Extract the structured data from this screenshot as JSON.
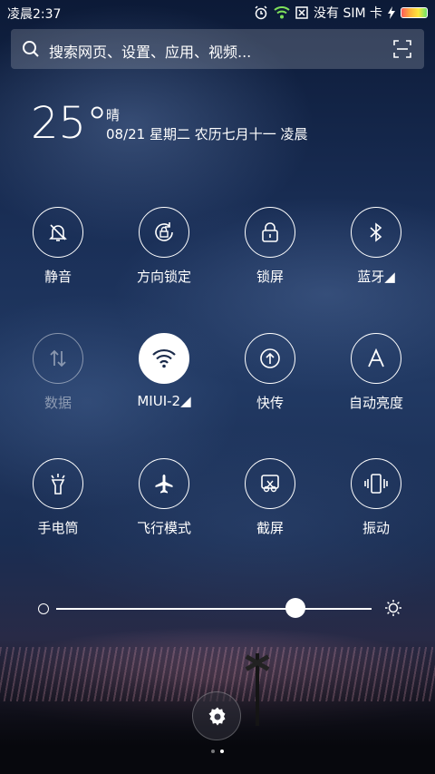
{
  "status": {
    "time": "凌晨2:37",
    "carrier": "没有 SIM 卡",
    "icons": [
      "alarm-icon",
      "wifi-icon",
      "no-sim-icon",
      "charging-icon",
      "battery-icon"
    ]
  },
  "search": {
    "placeholder": "搜索网页、设置、应用、视频..."
  },
  "weather": {
    "temp": "25°",
    "condition": "晴",
    "date": "08/21  星期二  农历七月十一  凌晨"
  },
  "toggles": [
    {
      "label": "静音",
      "icon": "bell-off-icon",
      "active": false,
      "dim": false
    },
    {
      "label": "方向锁定",
      "icon": "rotation-lock-icon",
      "active": false,
      "dim": false
    },
    {
      "label": "锁屏",
      "icon": "lock-icon",
      "active": false,
      "dim": false
    },
    {
      "label": "蓝牙◢",
      "icon": "bluetooth-icon",
      "active": false,
      "dim": false
    },
    {
      "label": "数据",
      "icon": "mobile-data-icon",
      "active": false,
      "dim": true
    },
    {
      "label": "MIUI-2◢",
      "icon": "wifi-icon",
      "active": true,
      "dim": false
    },
    {
      "label": "快传",
      "icon": "upload-icon",
      "active": false,
      "dim": false
    },
    {
      "label": "自动亮度",
      "icon": "auto-brightness-icon",
      "active": false,
      "dim": false
    },
    {
      "label": "手电筒",
      "icon": "flashlight-icon",
      "active": false,
      "dim": false
    },
    {
      "label": "飞行模式",
      "icon": "airplane-icon",
      "active": false,
      "dim": false
    },
    {
      "label": "截屏",
      "icon": "screenshot-icon",
      "active": false,
      "dim": false
    },
    {
      "label": "振动",
      "icon": "vibrate-icon",
      "active": false,
      "dim": false
    }
  ],
  "brightness": {
    "level": 0.76
  },
  "pager": {
    "pages": 2,
    "current": 2
  }
}
